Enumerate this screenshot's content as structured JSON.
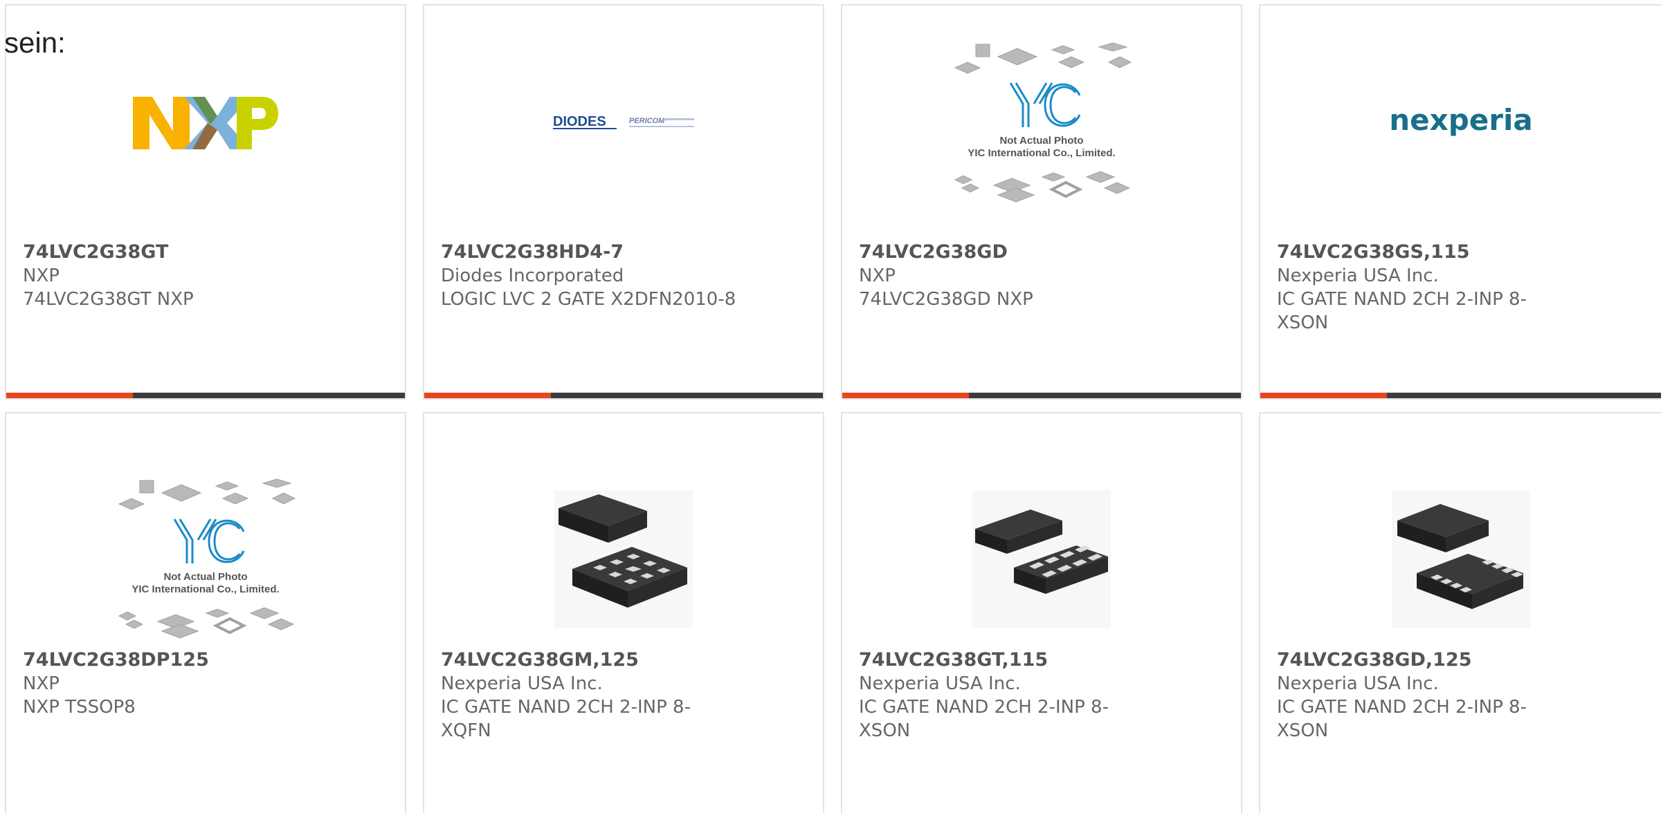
{
  "intro_text": "sein:",
  "accent_color": "#e8461e",
  "bar_color": "#3c3c3c",
  "products": [
    {
      "part_number": "74LVC2G38GT",
      "manufacturer": "NXP",
      "description": "74LVC2G38GT NXP",
      "image": "nxp-logo"
    },
    {
      "part_number": "74LVC2G38HD4-7",
      "manufacturer": "Diodes Incorporated",
      "description": "LOGIC LVC 2 GATE X2DFN2010-8",
      "image": "diodes-pericom-logo",
      "logo_text": "DIODES",
      "logo_subtext": "PERICOM"
    },
    {
      "part_number": "74LVC2G38GD",
      "manufacturer": "NXP",
      "description": "74LVC2G38GD NXP",
      "image": "yic-placeholder",
      "placeholder_line1": "Not Actual Photo",
      "placeholder_line2": "YIC International Co., Limited."
    },
    {
      "part_number": "74LVC2G38GS,115",
      "manufacturer": "Nexperia USA Inc.",
      "description": "IC GATE NAND 2CH 2-INP 8-XSON",
      "image": "nexperia-logo",
      "logo_text": "nexperia"
    },
    {
      "part_number": "74LVC2G38DP125",
      "manufacturer": "NXP",
      "description": "NXP TSSOP8",
      "image": "yic-placeholder",
      "placeholder_line1": "Not Actual Photo",
      "placeholder_line2": "YIC International Co., Limited."
    },
    {
      "part_number": "74LVC2G38GM,125",
      "manufacturer": "Nexperia USA Inc.",
      "description": "IC GATE NAND 2CH 2-INP 8-XQFN",
      "image": "xqfn-chip-photo"
    },
    {
      "part_number": "74LVC2G38GT,115",
      "manufacturer": "Nexperia USA Inc.",
      "description": "IC GATE NAND 2CH 2-INP 8-XSON",
      "image": "xson-chip-photo"
    },
    {
      "part_number": "74LVC2G38GD,125",
      "manufacturer": "Nexperia USA Inc.",
      "description": "IC GATE NAND 2CH 2-INP 8-XSON",
      "image": "xson-chip-photo"
    }
  ]
}
